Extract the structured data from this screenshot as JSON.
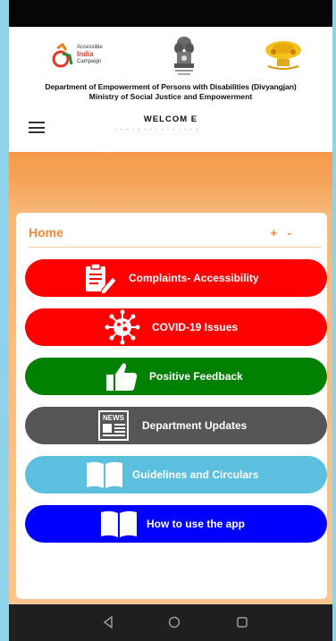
{
  "header": {
    "department_line1": "Department of Empowerment of Persons with Disabilities (Divyangjan)",
    "department_line2": "Ministry of Social Justice and Empowerment",
    "welcome": "WELCOM E",
    "logos": {
      "campaign": {
        "line1": "Accessible",
        "line2": "India",
        "line3": "Campaign"
      }
    }
  },
  "card": {
    "title": "Home",
    "zoom_in": "+",
    "zoom_out": "-"
  },
  "buttons": [
    {
      "label": "Complaints- Accessibility",
      "color": "#ff0000",
      "icon": "clipboard-edit-icon"
    },
    {
      "label": "COVID-19 Issues",
      "color": "#ff0000",
      "icon": "virus-icon"
    },
    {
      "label": "Positive Feedback",
      "color": "#008000",
      "icon": "thumbs-up-icon"
    },
    {
      "label": "Department Updates",
      "color": "#555555",
      "icon": "newspaper-icon"
    },
    {
      "label": "Guidelines and Circulars",
      "color": "#5bc0de",
      "icon": "open-book-icon"
    },
    {
      "label": "How to use the app",
      "color": "#0000ff",
      "icon": "open-book-icon"
    }
  ],
  "colors": {
    "accent": "#f08a3a",
    "orange_bg": "#f5a35a",
    "app_bg": "#8fd3e8"
  },
  "navbar": {
    "back_icon": "back-triangle-icon",
    "home_icon": "home-circle-icon",
    "recents_icon": "recents-square-icon"
  }
}
